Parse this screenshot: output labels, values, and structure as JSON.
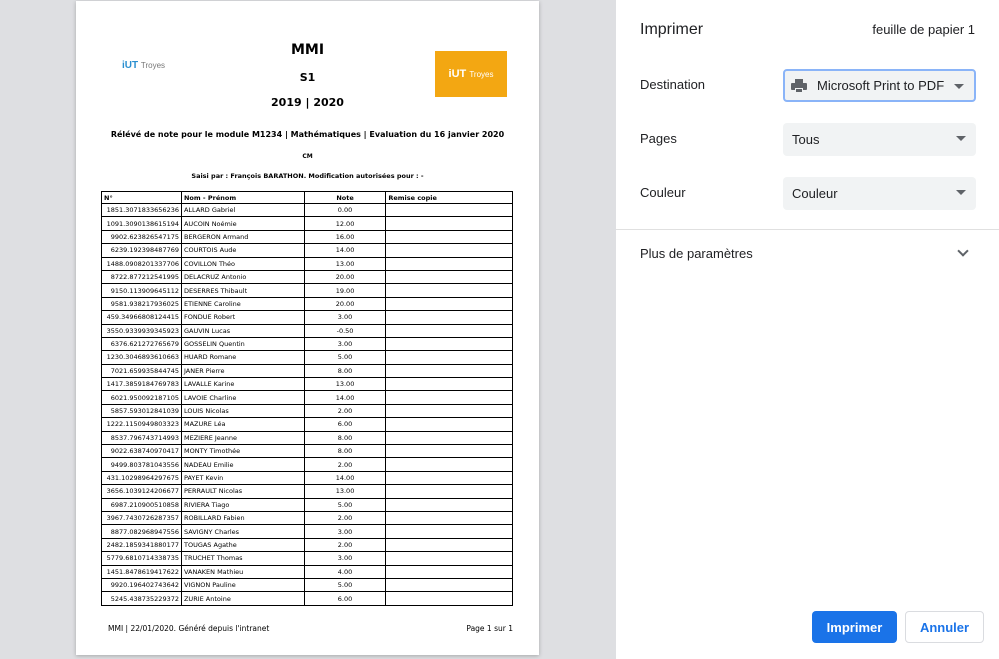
{
  "document": {
    "logo_left": {
      "brand": "iUT",
      "city": "Troyes"
    },
    "logo_right": {
      "brand": "iUT",
      "city": "Troyes"
    },
    "title": "MMI",
    "semester": "S1",
    "year": "2019 | 2020",
    "releve": "Rélévé de note pour le module M1234 | Mathématiques | Evaluation du 16 janvier 2020",
    "type": "CM",
    "saisi": "Saisi par : François BARATHON. Modification autorisées pour : -",
    "columns": [
      "N°",
      "Nom - Prénom",
      "Note",
      "Remise copie"
    ],
    "rows": [
      {
        "id": "1851.3071833656236",
        "name": "ALLARD Gabriel",
        "note": "0.00"
      },
      {
        "id": "1091.3090138615194",
        "name": "AUCOIN Noémie",
        "note": "12.00"
      },
      {
        "id": "9902.623826547175",
        "name": "BERGERON Armand",
        "note": "16.00"
      },
      {
        "id": "6239.192398487769",
        "name": "COURTOIS Aude",
        "note": "14.00"
      },
      {
        "id": "1488.0908201337706",
        "name": "COVILLON Théo",
        "note": "13.00"
      },
      {
        "id": "8722.877212541995",
        "name": "DELACRUZ Antonio",
        "note": "20.00"
      },
      {
        "id": "9150.113909645112",
        "name": "DESERRES Thibault",
        "note": "19.00"
      },
      {
        "id": "9581.938217936025",
        "name": "ETIENNE Caroline",
        "note": "20.00"
      },
      {
        "id": "459.3496680812441​5",
        "name": "FONDUE Robert",
        "note": "3.00"
      },
      {
        "id": "3550.9339939345923",
        "name": "GAUVIN Lucas",
        "note": "-0.50"
      },
      {
        "id": "6376.621272765679",
        "name": "GOSSELIN Quentin",
        "note": "3.00"
      },
      {
        "id": "1230.3046893610663",
        "name": "HUARD Romane",
        "note": "5.00"
      },
      {
        "id": "7021.659935844745",
        "name": "JANER Pierre",
        "note": "8.00"
      },
      {
        "id": "1417.3859184769783",
        "name": "LAVALLE Karine",
        "note": "13.00"
      },
      {
        "id": "6021.950092187105",
        "name": "LAVOIE Charline",
        "note": "14.00"
      },
      {
        "id": "5857.593012841039",
        "name": "LOUIS Nicolas",
        "note": "2.00"
      },
      {
        "id": "1222.1150949803323",
        "name": "MAZURE Léa",
        "note": "6.00"
      },
      {
        "id": "8537.796743714993",
        "name": "MEZIERE Jeanne",
        "note": "8.00"
      },
      {
        "id": "9022.638740970417",
        "name": "MONTY Timothée",
        "note": "8.00"
      },
      {
        "id": "9499.803781043556",
        "name": "NADEAU Emilie",
        "note": "2.00"
      },
      {
        "id": "431.1029896429767​5",
        "name": "PAYET Kevin",
        "note": "14.00"
      },
      {
        "id": "3656.1039124206677",
        "name": "PERRAULT Nicolas",
        "note": "13.00"
      },
      {
        "id": "6987.210900510858",
        "name": "RIVIERA Tiago",
        "note": "5.00"
      },
      {
        "id": "3967.7430726287357",
        "name": "ROBILLARD Fabien",
        "note": "2.00"
      },
      {
        "id": "8877.082968947556",
        "name": "SAVIGNY Charles",
        "note": "3.00"
      },
      {
        "id": "2482.1859341880177",
        "name": "TOUGAS Agathe",
        "note": "2.00"
      },
      {
        "id": "5779.6810714338735",
        "name": "TRUCHET Thomas",
        "note": "3.00"
      },
      {
        "id": "1451.8478619417622",
        "name": "VANAKEN Mathieu",
        "note": "4.00"
      },
      {
        "id": "9920.196402743642",
        "name": "VIGNON Pauline",
        "note": "5.00"
      },
      {
        "id": "5245.438735229372",
        "name": "ZURIE Antoine",
        "note": "6.00"
      }
    ],
    "footer_left": "MMI | 22/01/2020. Généré depuis l'intranet",
    "footer_right": "Page 1 sur 1"
  },
  "panel": {
    "title": "Imprimer",
    "sheet_count": "feuille de papier 1",
    "destination": {
      "label": "Destination",
      "value": "Microsoft Print to PDF",
      "icon": "printer-icon"
    },
    "pages": {
      "label": "Pages",
      "value": "Tous"
    },
    "color": {
      "label": "Couleur",
      "value": "Couleur"
    },
    "more": "Plus de paramètres",
    "print_button": "Imprimer",
    "cancel_button": "Annuler",
    "accent_color": "#1a73e8"
  }
}
